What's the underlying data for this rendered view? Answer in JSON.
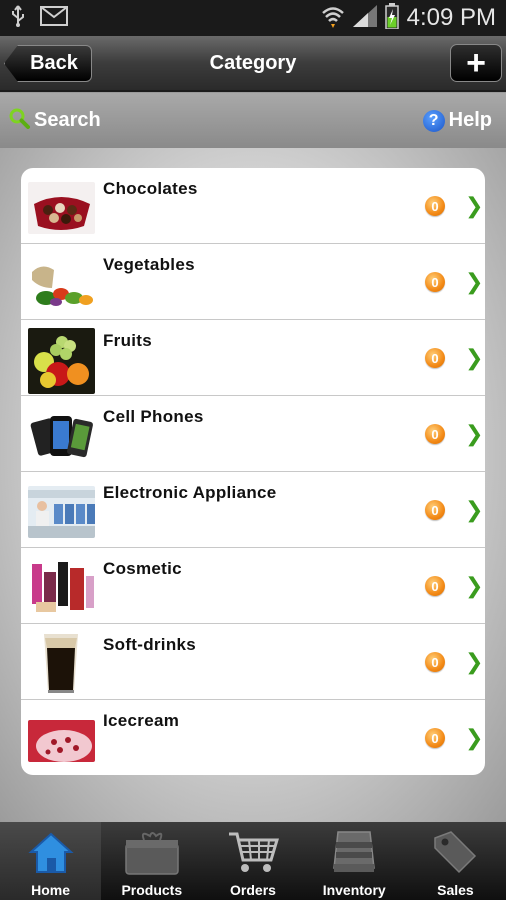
{
  "status_bar": {
    "time": "4:09 PM",
    "icons": [
      "usb-icon",
      "mail-icon",
      "wifi-icon",
      "signal-icon",
      "battery-charging-icon"
    ]
  },
  "header": {
    "back_label": "Back",
    "title": "Category",
    "add_label": "+"
  },
  "toolbar": {
    "search_label": "Search",
    "help_label": "Help",
    "help_glyph": "?"
  },
  "categories": [
    {
      "label": "Chocolates",
      "thumb": "chocolates-image"
    },
    {
      "label": "Vegetables",
      "thumb": "vegetables-image"
    },
    {
      "label": "Fruits",
      "thumb": "fruits-image"
    },
    {
      "label": "Cell Phones",
      "thumb": "cell-phones-image"
    },
    {
      "label": "Electronic  Appliance",
      "thumb": "electronic-appliance-image"
    },
    {
      "label": "Cosmetic",
      "thumb": "cosmetic-image"
    },
    {
      "label": "Soft-drinks",
      "thumb": "soft-drinks-image"
    },
    {
      "label": "Icecream",
      "thumb": "icecream-image"
    }
  ],
  "item_actions": {
    "info_glyph": "0",
    "chevron_glyph": "❯"
  },
  "tabs": [
    {
      "label": "Home",
      "icon": "home-icon",
      "active": true
    },
    {
      "label": "Products",
      "icon": "products-icon",
      "active": false
    },
    {
      "label": "Orders",
      "icon": "cart-icon",
      "active": false
    },
    {
      "label": "Inventory",
      "icon": "inventory-icon",
      "active": false
    },
    {
      "label": "Sales",
      "icon": "tag-icon",
      "active": false
    }
  ],
  "colors": {
    "accent_green": "#3a9c1e",
    "info_orange": "#f38a16",
    "help_blue": "#1a55c8",
    "home_blue": "#2f8fe0"
  }
}
